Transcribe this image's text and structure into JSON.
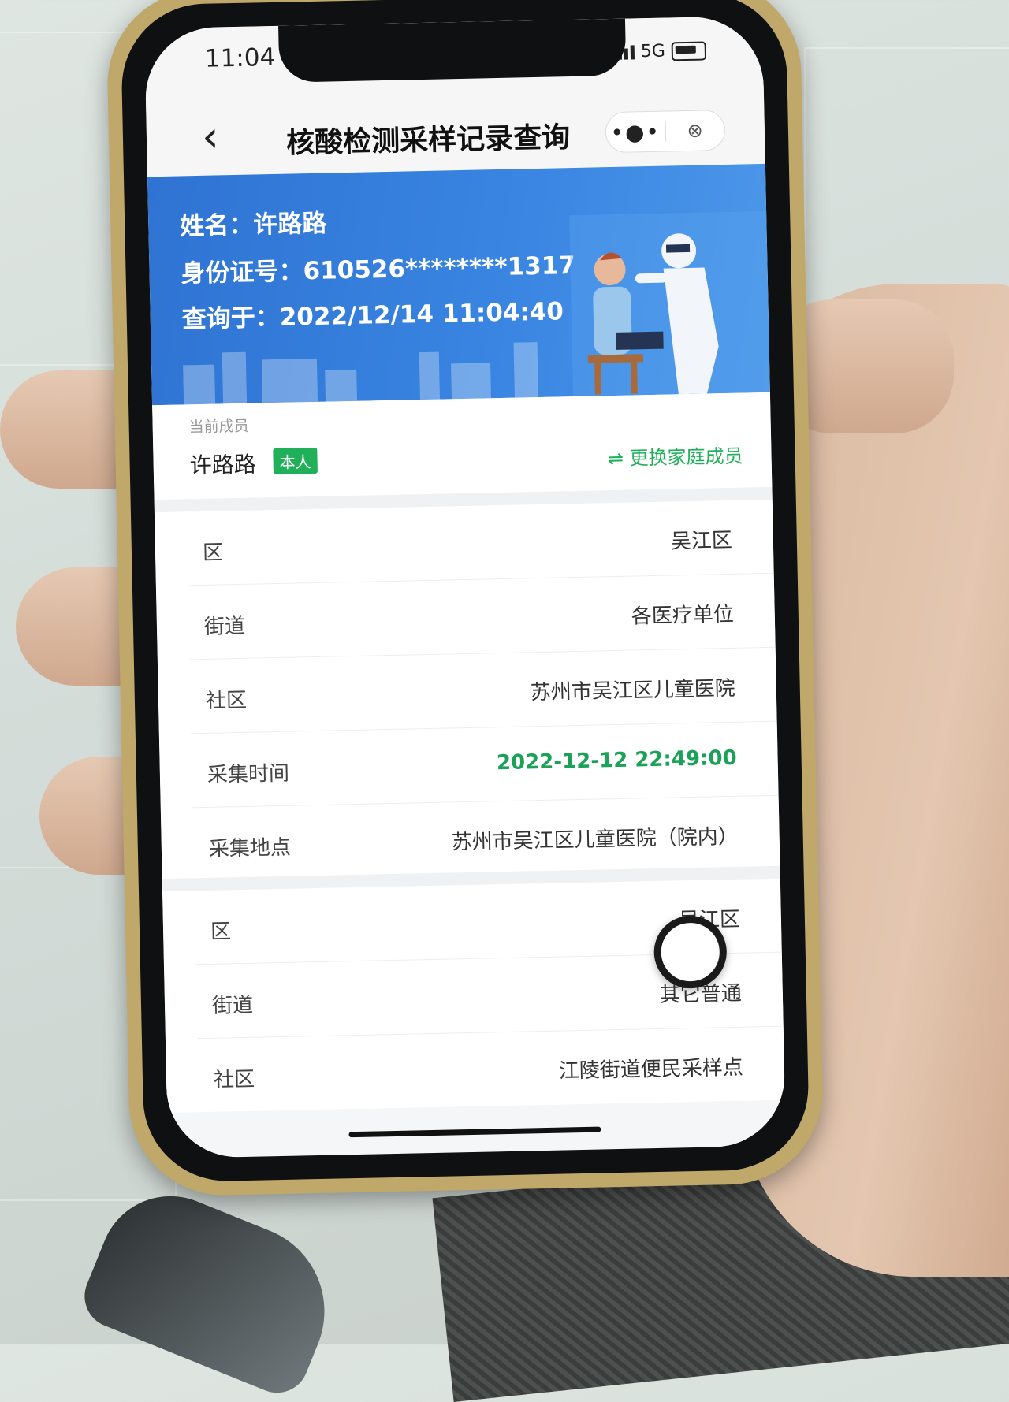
{
  "status_bar": {
    "time": "11:04",
    "network": "5G"
  },
  "nav": {
    "back_glyph": "‹",
    "title": "核酸检测采样记录查询",
    "more_glyph": "•●•",
    "close_glyph": "⊗"
  },
  "banner": {
    "name_line": "姓名：许路路",
    "id_line": "身份证号：610526********1317",
    "query_line": "查询于：2022/12/14 11:04:40"
  },
  "member": {
    "caption": "当前成员",
    "name": "许路路",
    "badge": "本人",
    "switch_label": "⇌ 更换家庭成员"
  },
  "records": [
    {
      "rows": [
        {
          "label": "区",
          "value": "吴江区"
        },
        {
          "label": "街道",
          "value": "各医疗单位"
        },
        {
          "label": "社区",
          "value": "苏州市吴江区儿童医院"
        },
        {
          "label": "采集时间",
          "value": "2022-12-12 22:49:00"
        },
        {
          "label": "采集地点",
          "value": "苏州市吴江区儿童医院（院内）"
        }
      ]
    },
    {
      "rows": [
        {
          "label": "区",
          "value": "吴江区"
        },
        {
          "label": "街道",
          "value": "其它普通"
        },
        {
          "label": "社区",
          "value": "江陵街道便民采样点"
        }
      ]
    }
  ],
  "colors": {
    "banner_blue": "#3a86e2",
    "accent_green": "#20b05a",
    "phone_frame": "#bfa86a"
  }
}
